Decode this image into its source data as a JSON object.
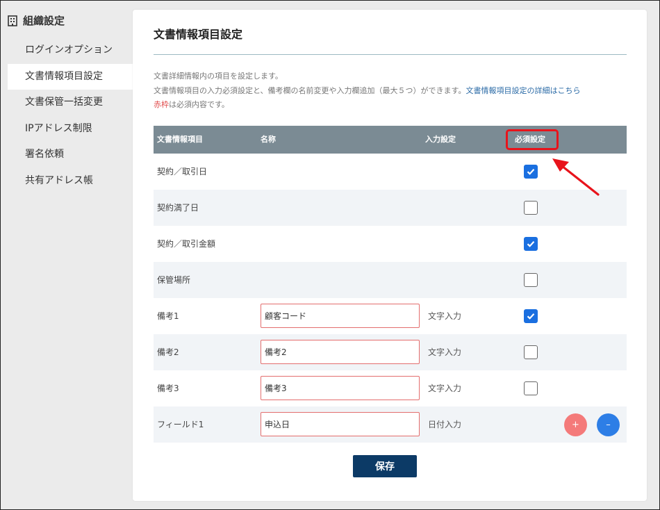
{
  "sidebar": {
    "title": "組織設定",
    "items": [
      {
        "label": "ログインオプション",
        "active": false
      },
      {
        "label": "文書情報項目設定",
        "active": true
      },
      {
        "label": "文書保管一括変更",
        "active": false
      },
      {
        "label": "IPアドレス制限",
        "active": false
      },
      {
        "label": "署名依頼",
        "active": false
      },
      {
        "label": "共有アドレス帳",
        "active": false
      }
    ]
  },
  "main": {
    "title": "文書情報項目設定",
    "desc_line1": "文書詳細情報内の項目を設定します。",
    "desc_line2": "文書情報項目の入力必須設定と、備考欄の名前変更や入力欄追加（最大５つ）ができます。",
    "desc_link": "文書情報項目設定の詳細はこちら",
    "desc_red": "赤枠",
    "desc_line3_rest": "は必須内容です。",
    "table": {
      "headers": {
        "item": "文書情報項目",
        "name": "名称",
        "input": "入力設定",
        "required": "必須設定"
      },
      "rows": [
        {
          "label": "契約／取引日",
          "name": "",
          "input_type": "",
          "required": true
        },
        {
          "label": "契約満了日",
          "name": "",
          "input_type": "",
          "required": false
        },
        {
          "label": "契約／取引金額",
          "name": "",
          "input_type": "",
          "required": true
        },
        {
          "label": "保管場所",
          "name": "",
          "input_type": "",
          "required": false
        },
        {
          "label": "備考1",
          "name": "顧客コード",
          "input_type": "文字入力",
          "required": true
        },
        {
          "label": "備考2",
          "name": "備考2",
          "input_type": "文字入力",
          "required": false
        },
        {
          "label": "備考3",
          "name": "備考3",
          "input_type": "文字入力",
          "required": false
        },
        {
          "label": "フィールド1",
          "name": "申込日",
          "input_type": "日付入力",
          "required": null
        }
      ]
    },
    "add_symbol": "+",
    "remove_symbol": "–",
    "save_label": "保存"
  },
  "colors": {
    "header_bg": "#7b8b94",
    "checkbox": "#1a6fe0",
    "highlight": "#e8131b",
    "save_button": "#0c3a66",
    "add_button": "#f47a7a",
    "remove_button": "#2d7ee6"
  },
  "icons": {
    "sidebar_header": "building-icon",
    "checkbox_mark": "check-icon",
    "annotation": "red-arrow-icon"
  }
}
